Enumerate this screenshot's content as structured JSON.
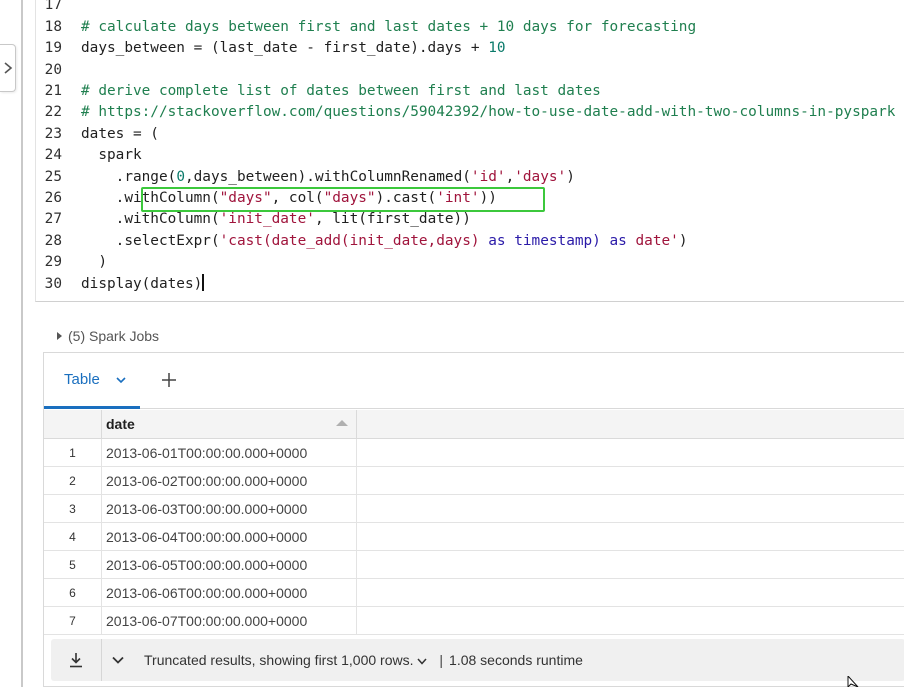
{
  "code_lines": [
    {
      "n": "17",
      "parts": []
    },
    {
      "n": "18",
      "parts": [
        {
          "t": "# calculate days between first and last dates + 10 days for forecasting",
          "c": "cm"
        }
      ]
    },
    {
      "n": "19",
      "parts": [
        {
          "t": "days_between = (last_date - first_date).days + ",
          "c": ""
        },
        {
          "t": "10",
          "c": "num"
        }
      ]
    },
    {
      "n": "20",
      "parts": []
    },
    {
      "n": "21",
      "parts": [
        {
          "t": "# derive complete list of dates between first and last dates",
          "c": "cm"
        }
      ]
    },
    {
      "n": "22",
      "parts": [
        {
          "t": "# https://stackoverflow.com/questions/59042392/how-to-use-date-add-with-two-columns-in-pyspark",
          "c": "cm"
        }
      ]
    },
    {
      "n": "23",
      "parts": [
        {
          "t": "dates = (",
          "c": ""
        }
      ]
    },
    {
      "n": "24",
      "parts": [
        {
          "t": "  spark",
          "c": ""
        }
      ]
    },
    {
      "n": "25",
      "parts": [
        {
          "t": "    .range(",
          "c": ""
        },
        {
          "t": "0",
          "c": "num"
        },
        {
          "t": ",days_between).withColumnRenamed(",
          "c": ""
        },
        {
          "t": "'id'",
          "c": "str"
        },
        {
          "t": ",",
          "c": ""
        },
        {
          "t": "'days'",
          "c": "str"
        },
        {
          "t": ")",
          "c": ""
        }
      ]
    },
    {
      "n": "26",
      "parts": [
        {
          "t": "    .withColumn(",
          "c": ""
        },
        {
          "t": "\"days\"",
          "c": "str"
        },
        {
          "t": ", col(",
          "c": ""
        },
        {
          "t": "\"days\"",
          "c": "str"
        },
        {
          "t": ").cast(",
          "c": ""
        },
        {
          "t": "'int'",
          "c": "str"
        },
        {
          "t": "))",
          "c": ""
        }
      ]
    },
    {
      "n": "27",
      "parts": [
        {
          "t": "    .withColumn(",
          "c": ""
        },
        {
          "t": "'init_date'",
          "c": "str"
        },
        {
          "t": ", lit(first_date))",
          "c": ""
        }
      ]
    },
    {
      "n": "28",
      "parts": [
        {
          "t": "    .selectExpr(",
          "c": ""
        },
        {
          "t": "'cast(date_add(init_date,days) ",
          "c": "str"
        },
        {
          "t": "as",
          "c": "kw"
        },
        {
          "t": " timestamp) ",
          "c": "kw"
        },
        {
          "t": "as",
          "c": "kw"
        },
        {
          "t": " date'",
          "c": "str"
        },
        {
          "t": ")",
          "c": ""
        }
      ]
    },
    {
      "n": "29",
      "parts": [
        {
          "t": "  )",
          "c": ""
        }
      ]
    },
    {
      "n": "30",
      "parts": [
        {
          "t": "display(dates)",
          "c": ""
        }
      ]
    }
  ],
  "spark_jobs": {
    "label": "(5) Spark Jobs"
  },
  "results": {
    "tab_label": "Table",
    "column_header": "date",
    "rows": [
      {
        "index": "1",
        "date": "2013-06-01T00:00:00.000+0000"
      },
      {
        "index": "2",
        "date": "2013-06-02T00:00:00.000+0000"
      },
      {
        "index": "3",
        "date": "2013-06-03T00:00:00.000+0000"
      },
      {
        "index": "4",
        "date": "2013-06-04T00:00:00.000+0000"
      },
      {
        "index": "5",
        "date": "2013-06-05T00:00:00.000+0000"
      },
      {
        "index": "6",
        "date": "2013-06-06T00:00:00.000+0000"
      },
      {
        "index": "7",
        "date": "2013-06-07T00:00:00.000+0000"
      }
    ],
    "footer": {
      "truncated_text": "Truncated results, showing first 1,000 rows.",
      "separator": "|",
      "runtime_text": "1.08 seconds runtime"
    }
  },
  "colors": {
    "accent": "#1a6fbf",
    "highlight": "#3cc83c",
    "comment": "#1f7f4f",
    "string": "#a0143c"
  },
  "icons": {
    "expand": "chevron-right-icon",
    "spark_toggle": "triangle-right-icon",
    "tab_menu": "chevron-down-icon",
    "add_tab": "plus-icon",
    "sort": "sort-ascending-icon",
    "download": "download-icon",
    "more": "chevron-down-icon"
  }
}
